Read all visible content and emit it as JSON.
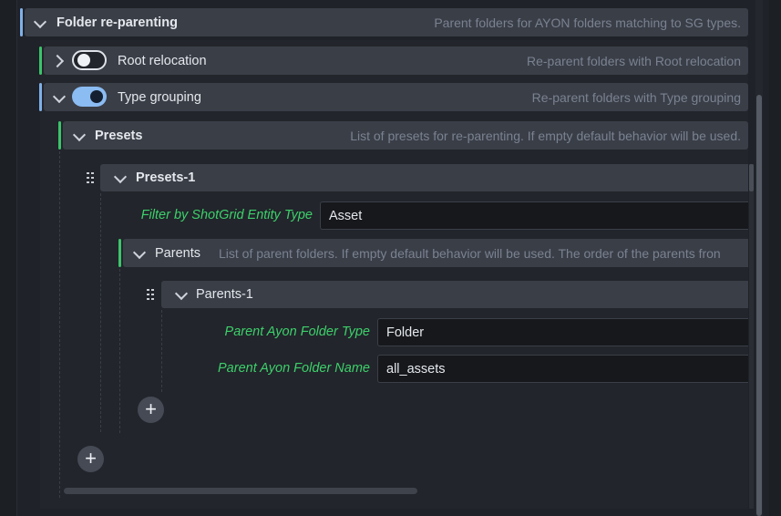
{
  "folder_reparenting": {
    "title": "Folder re-parenting",
    "description": "Parent folders for AYON folders matching to SG types."
  },
  "root_relocation": {
    "title": "Root relocation",
    "description": "Re-parent folders with Root relocation",
    "enabled": false
  },
  "type_grouping": {
    "title": "Type grouping",
    "description": "Re-parent folders with Type grouping",
    "enabled": true
  },
  "presets": {
    "title": "Presets",
    "description": "List of presets for re-parenting. If empty default behavior will be used.",
    "items": [
      {
        "title": "Presets-1",
        "filter_label": "Filter by ShotGrid Entity Type",
        "filter_value": "Asset",
        "parents": {
          "title": "Parents",
          "description": "List of parent folders. If empty default behavior will be used. The order of the parents fron",
          "items": [
            {
              "title": "Parents-1",
              "type_label": "Parent Ayon Folder Type",
              "type_value": "Folder",
              "name_label": "Parent Ayon Folder Name",
              "name_value": "all_assets"
            }
          ]
        }
      }
    ]
  },
  "add_symbol": "+",
  "colors": {
    "accent_blue": "#7fb0e8",
    "accent_green": "#3cc46b",
    "label_green": "#3dd06b"
  }
}
